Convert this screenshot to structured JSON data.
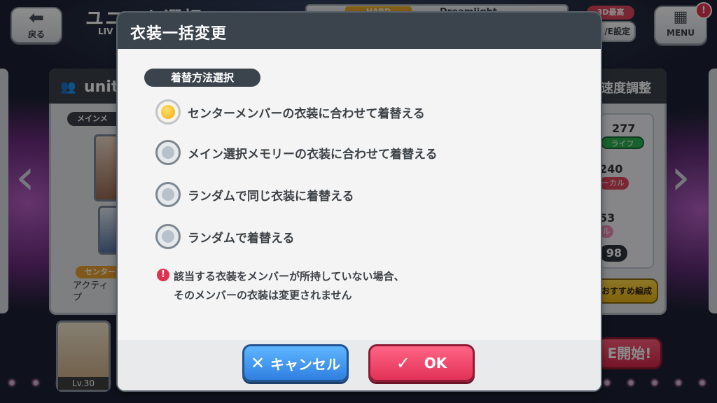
{
  "background": {
    "back_label": "戻る",
    "screen_title": "ユニット選択",
    "live_label": "LIV",
    "difficulty": "HARD",
    "song_name": "Dreamlight",
    "badge_3d": "3D最高",
    "live_settings": "/E設定",
    "menu_label": "MENU",
    "notice_mark": "!",
    "unit_label": "unit",
    "main_member_label": "メインメ",
    "center_label": "センター",
    "active_text": "アクティ\nプ",
    "level": "Lv.30",
    "speed_label": "速度調整",
    "stat_life_value": "277",
    "life_label": "ライフ",
    "stat_vocal_value": "240",
    "vocal_label": "ーカル",
    "stat_third_value": "53",
    "third_label": "ル",
    "stat_total_value": "98",
    "recommend_label": "おすすめ編成",
    "start_label": "E開始!"
  },
  "dialog": {
    "title": "衣装一括変更",
    "section_label": "着替方法選択",
    "options": [
      {
        "label": "センターメンバーの衣装に合わせて着替える",
        "selected": true
      },
      {
        "label": "メイン選択メモリーの衣装に合わせて着替える",
        "selected": false
      },
      {
        "label": "ランダムで同じ衣装に着替える",
        "selected": false
      },
      {
        "label": "ランダムで着替える",
        "selected": false
      }
    ],
    "warning_icon": "!",
    "warning_line1": "該当する衣装をメンバーが所持していない場合、",
    "warning_line2": "そのメンバーの衣装は変更されません",
    "cancel_label": "キャンセル",
    "ok_label": "OK"
  },
  "colors": {
    "header": "#3b434c",
    "cancel": "#2f7fe0",
    "ok": "#e23157",
    "selected_radio": "#f4aa10"
  }
}
